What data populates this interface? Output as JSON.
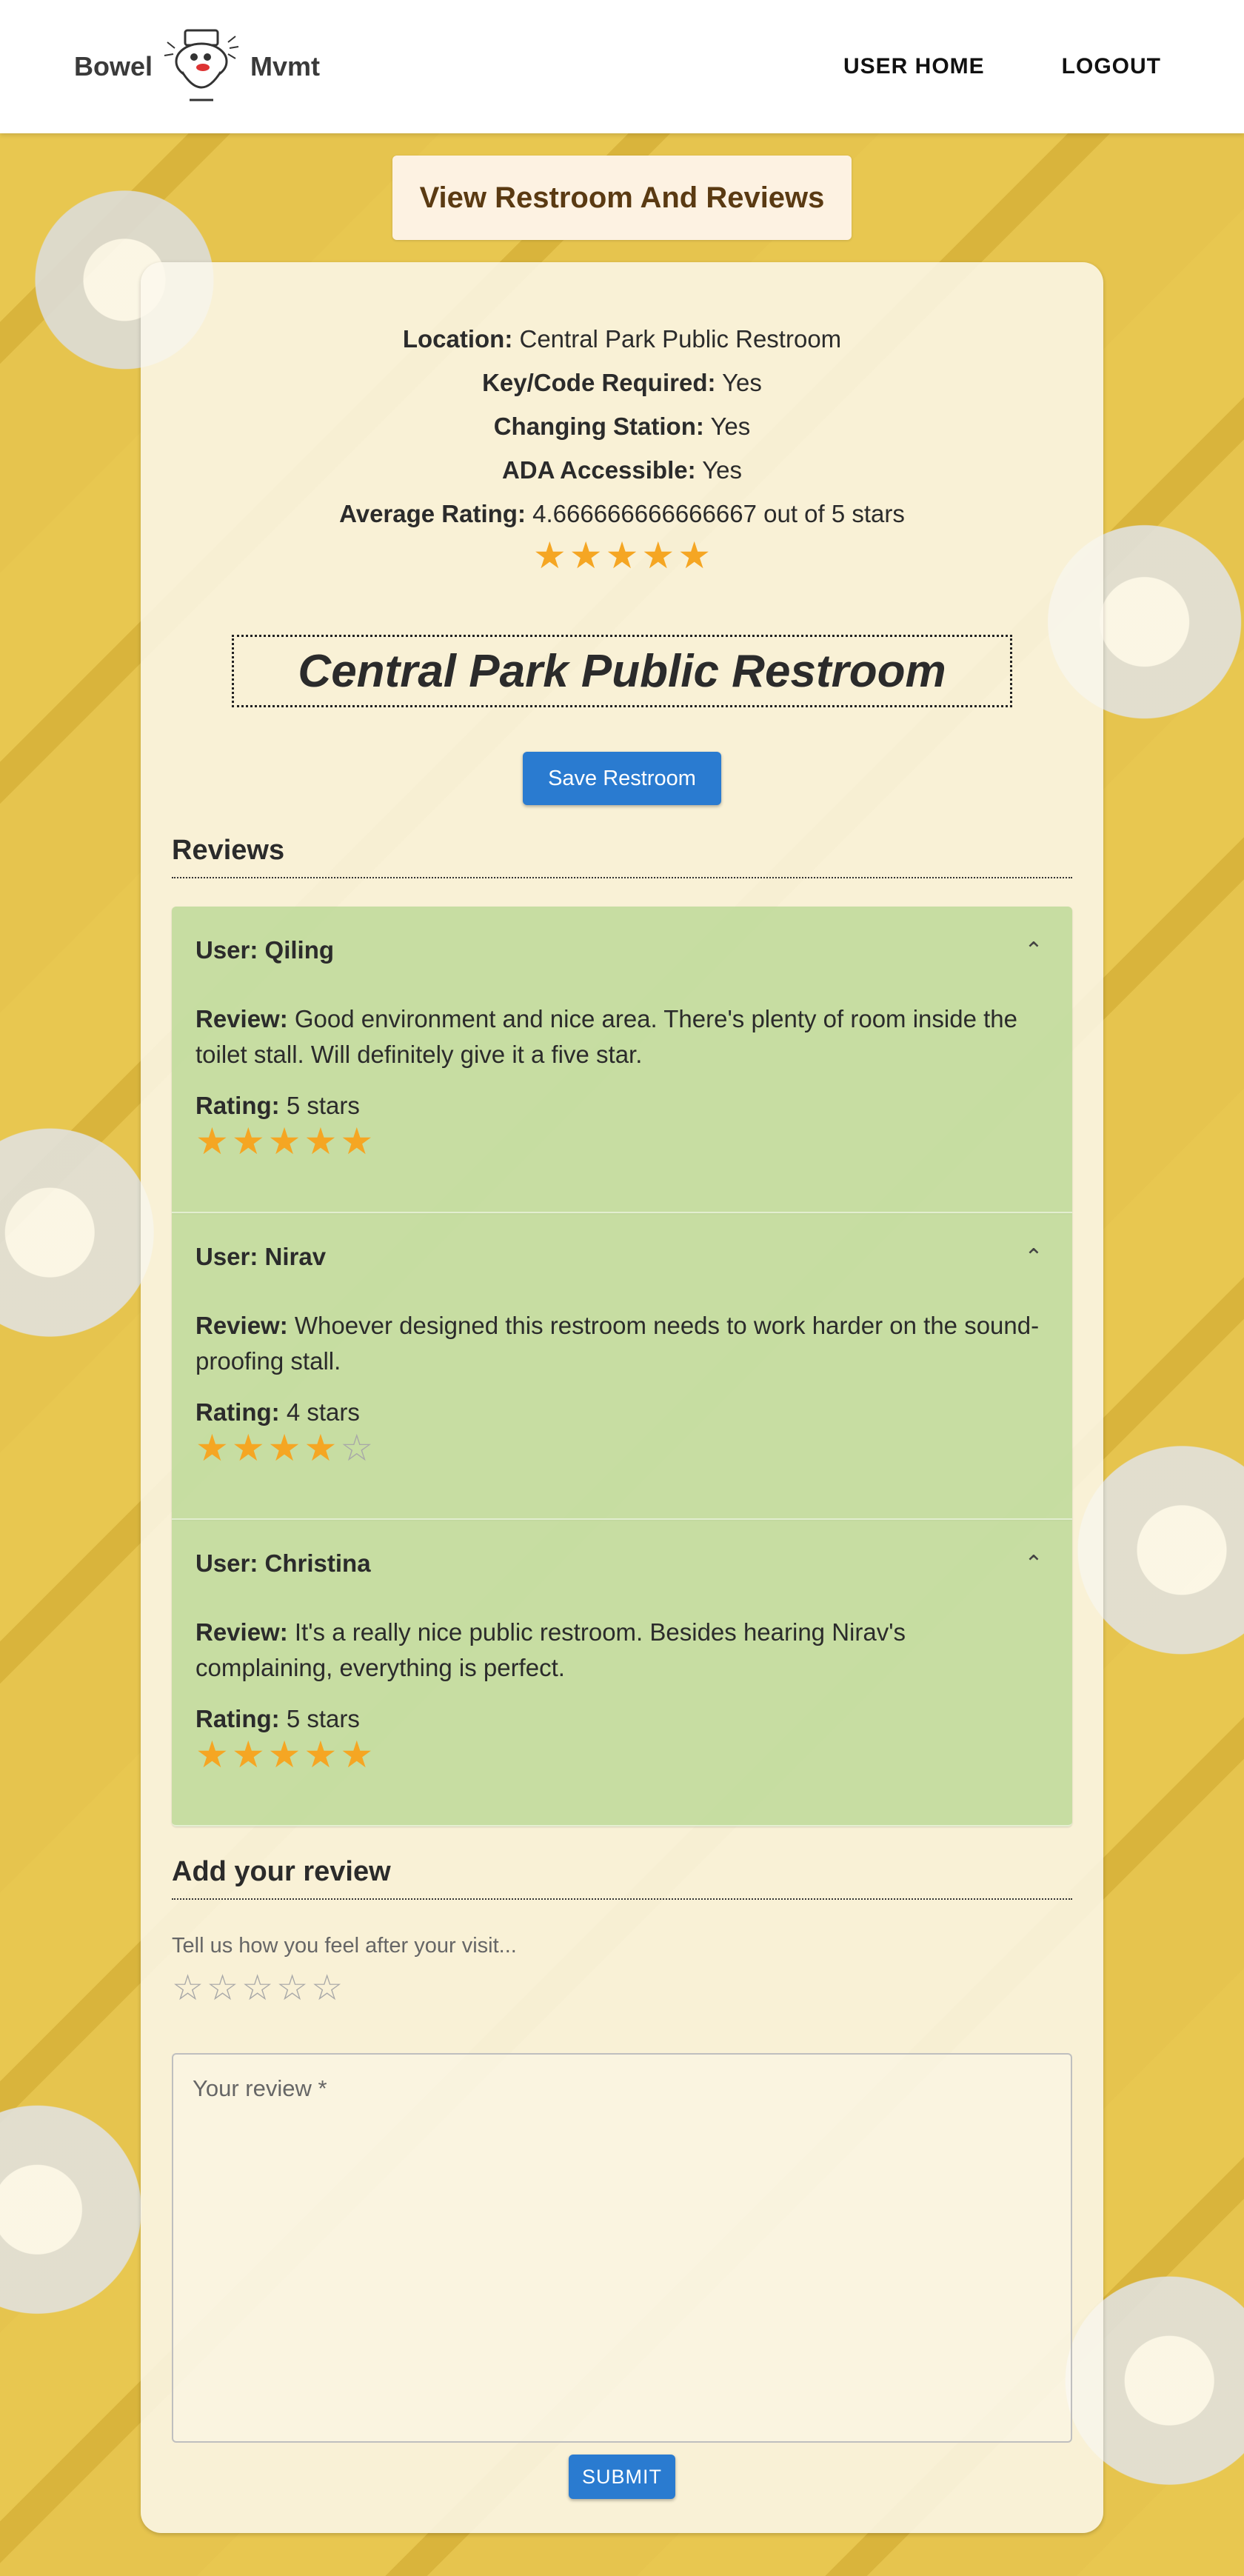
{
  "header": {
    "logo_left": "Bowel",
    "logo_right": "Mvmt",
    "nav": [
      "USER HOME",
      "LOGOUT"
    ]
  },
  "page_title": "View Restroom And Reviews",
  "restroom": {
    "location_label": "Location:",
    "location": "Central Park Public Restroom",
    "key_label": "Key/Code Required:",
    "key": "Yes",
    "changing_label": "Changing Station:",
    "changing": "Yes",
    "ada_label": "ADA Accessible:",
    "ada": "Yes",
    "avg_label": "Average Rating:",
    "avg": "4.666666666666667 out of 5 stars",
    "avg_stars_filled": 5,
    "name": "Central Park Public Restroom",
    "save_button": "Save Restroom"
  },
  "reviews_heading": "Reviews",
  "reviews": [
    {
      "user": "User: Qiling",
      "review_label": "Review:",
      "text": "Good environment and nice area. There's plenty of room inside the toilet stall. Will definitely give it a five star.",
      "rating_label": "Rating:",
      "rating_text": "5 stars",
      "stars_filled": 5
    },
    {
      "user": "User: Nirav",
      "review_label": "Review:",
      "text": "Whoever designed this restroom needs to work harder on the sound-proofing stall.",
      "rating_label": "Rating:",
      "rating_text": "4 stars",
      "stars_filled": 4
    },
    {
      "user": "User: Christina",
      "review_label": "Review:",
      "text": "It's a really nice public restroom. Besides hearing Nirav's complaining, everything is perfect.",
      "rating_label": "Rating:",
      "rating_text": "5 stars",
      "stars_filled": 5
    }
  ],
  "add_review": {
    "heading": "Add your review",
    "prompt": "Tell us how you feel after your visit...",
    "stars_filled": 0,
    "placeholder": "Your review *",
    "submit": "SUBMIT"
  },
  "colors": {
    "star_filled": "#f5a623",
    "star_empty": "#a8a8a8",
    "button": "#2a7bd0",
    "review_bg": "#b8d794"
  }
}
